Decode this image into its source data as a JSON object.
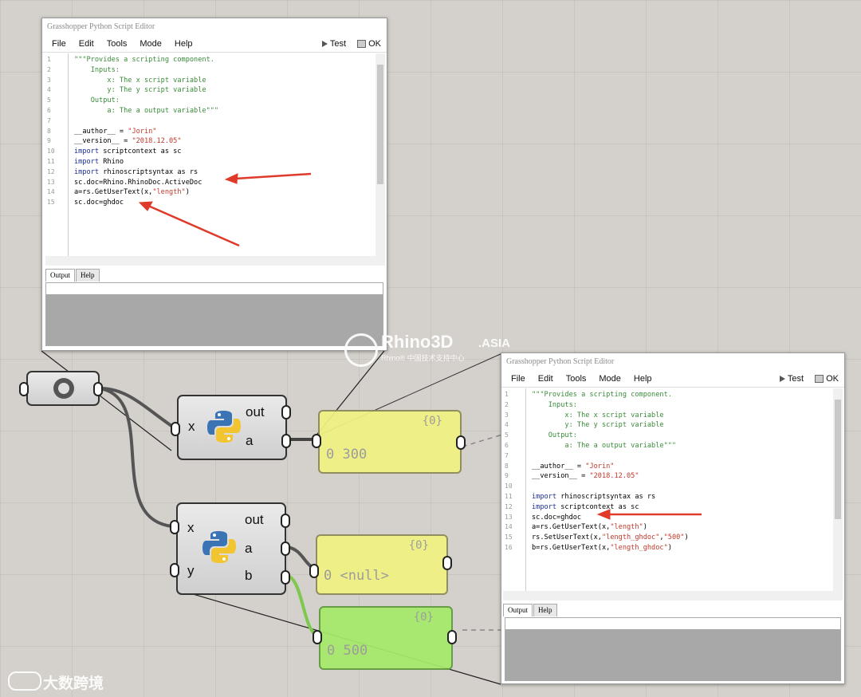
{
  "editor_top": {
    "title": "Grasshopper Python Script Editor",
    "menu": [
      "File",
      "Edit",
      "Tools",
      "Mode",
      "Help"
    ],
    "test_label": "Test",
    "ok_label": "OK",
    "tabs": [
      "Output",
      "Help"
    ],
    "lines": [
      {
        "n": "1",
        "t": "\"\"\"Provides a scripting component.",
        "k": "str"
      },
      {
        "n": "2",
        "t": "    Inputs:",
        "k": "str"
      },
      {
        "n": "3",
        "t": "        x: The x script variable",
        "k": "str"
      },
      {
        "n": "4",
        "t": "        y: The y script variable",
        "k": "str"
      },
      {
        "n": "5",
        "t": "    Output:",
        "k": "str"
      },
      {
        "n": "6",
        "t": "        a: The a output variable\"\"\"",
        "k": "str"
      },
      {
        "n": "7",
        "t": "",
        "k": "plain"
      },
      {
        "n": "8",
        "t": "__author__ = \"Jorin\"",
        "k": "assign"
      },
      {
        "n": "9",
        "t": "__version__ = \"2018.12.05\"",
        "k": "assign"
      },
      {
        "n": "10",
        "t": "import scriptcontext as sc",
        "k": "import"
      },
      {
        "n": "11",
        "t": "import Rhino",
        "k": "import"
      },
      {
        "n": "12",
        "t": "import rhinoscriptsyntax as rs",
        "k": "import"
      },
      {
        "n": "13",
        "t": "sc.doc=Rhino.RhinoDoc.ActiveDoc",
        "k": "plain"
      },
      {
        "n": "14",
        "t": "a=rs.GetUserText(x,\"length\")",
        "k": "plain"
      },
      {
        "n": "15",
        "t": "sc.doc=ghdoc",
        "k": "plain"
      }
    ]
  },
  "editor_bottom": {
    "title": "Grasshopper Python Script Editor",
    "menu": [
      "File",
      "Edit",
      "Tools",
      "Mode",
      "Help"
    ],
    "test_label": "Test",
    "ok_label": "OK",
    "tabs": [
      "Output",
      "Help"
    ],
    "lines": [
      {
        "n": "1",
        "t": "\"\"\"Provides a scripting component.",
        "k": "str"
      },
      {
        "n": "2",
        "t": "    Inputs:",
        "k": "str"
      },
      {
        "n": "3",
        "t": "        x: The x script variable",
        "k": "str"
      },
      {
        "n": "4",
        "t": "        y: The y script variable",
        "k": "str"
      },
      {
        "n": "5",
        "t": "    Output:",
        "k": "str"
      },
      {
        "n": "6",
        "t": "        a: The a output variable\"\"\"",
        "k": "str"
      },
      {
        "n": "7",
        "t": "",
        "k": "plain"
      },
      {
        "n": "8",
        "t": "__author__ = \"Jorin\"",
        "k": "assign"
      },
      {
        "n": "9",
        "t": "__version__ = \"2018.12.05\"",
        "k": "assign"
      },
      {
        "n": "10",
        "t": "",
        "k": "plain"
      },
      {
        "n": "11",
        "t": "import rhinoscriptsyntax as rs",
        "k": "import"
      },
      {
        "n": "12",
        "t": "import scriptcontext as sc",
        "k": "import"
      },
      {
        "n": "13",
        "t": "sc.doc=ghdoc",
        "k": "plain"
      },
      {
        "n": "14",
        "t": "a=rs.GetUserText(x,\"length\")",
        "k": "plain"
      },
      {
        "n": "15",
        "t": "rs.SetUserText(x,\"length_ghdoc\",\"500\")",
        "k": "plain"
      },
      {
        "n": "16",
        "t": "b=rs.GetUserText(x,\"length_ghdoc\")",
        "k": "plain"
      }
    ]
  },
  "canvas": {
    "comp1": {
      "in_x": "x",
      "out_out": "out",
      "out_a": "a"
    },
    "comp2": {
      "in_x": "x",
      "in_y": "y",
      "out_out": "out",
      "out_a": "a",
      "out_b": "b"
    },
    "panel1": {
      "path": "{0}",
      "value": "0 300"
    },
    "panel2": {
      "path": "{0}",
      "value": "0 <null>"
    },
    "panel3": {
      "path": "{0}",
      "value": "0 500"
    }
  },
  "watermarks": {
    "rhino_main": "Rhino3D",
    "rhino_suffix": ".ASIA",
    "rhino_sub": "Rhino® 中国技术支持中心",
    "corner": "大数跨境"
  },
  "colors": {
    "canvas_bg": "#d4d0cb",
    "panel_yellow": "#f2f283",
    "panel_green": "#a6ea6a",
    "annotation_red": "#e03a2a",
    "string_green": "#3a8c3a",
    "keyword_blue": "#1b2f9a",
    "quote_red": "#c0392b"
  }
}
